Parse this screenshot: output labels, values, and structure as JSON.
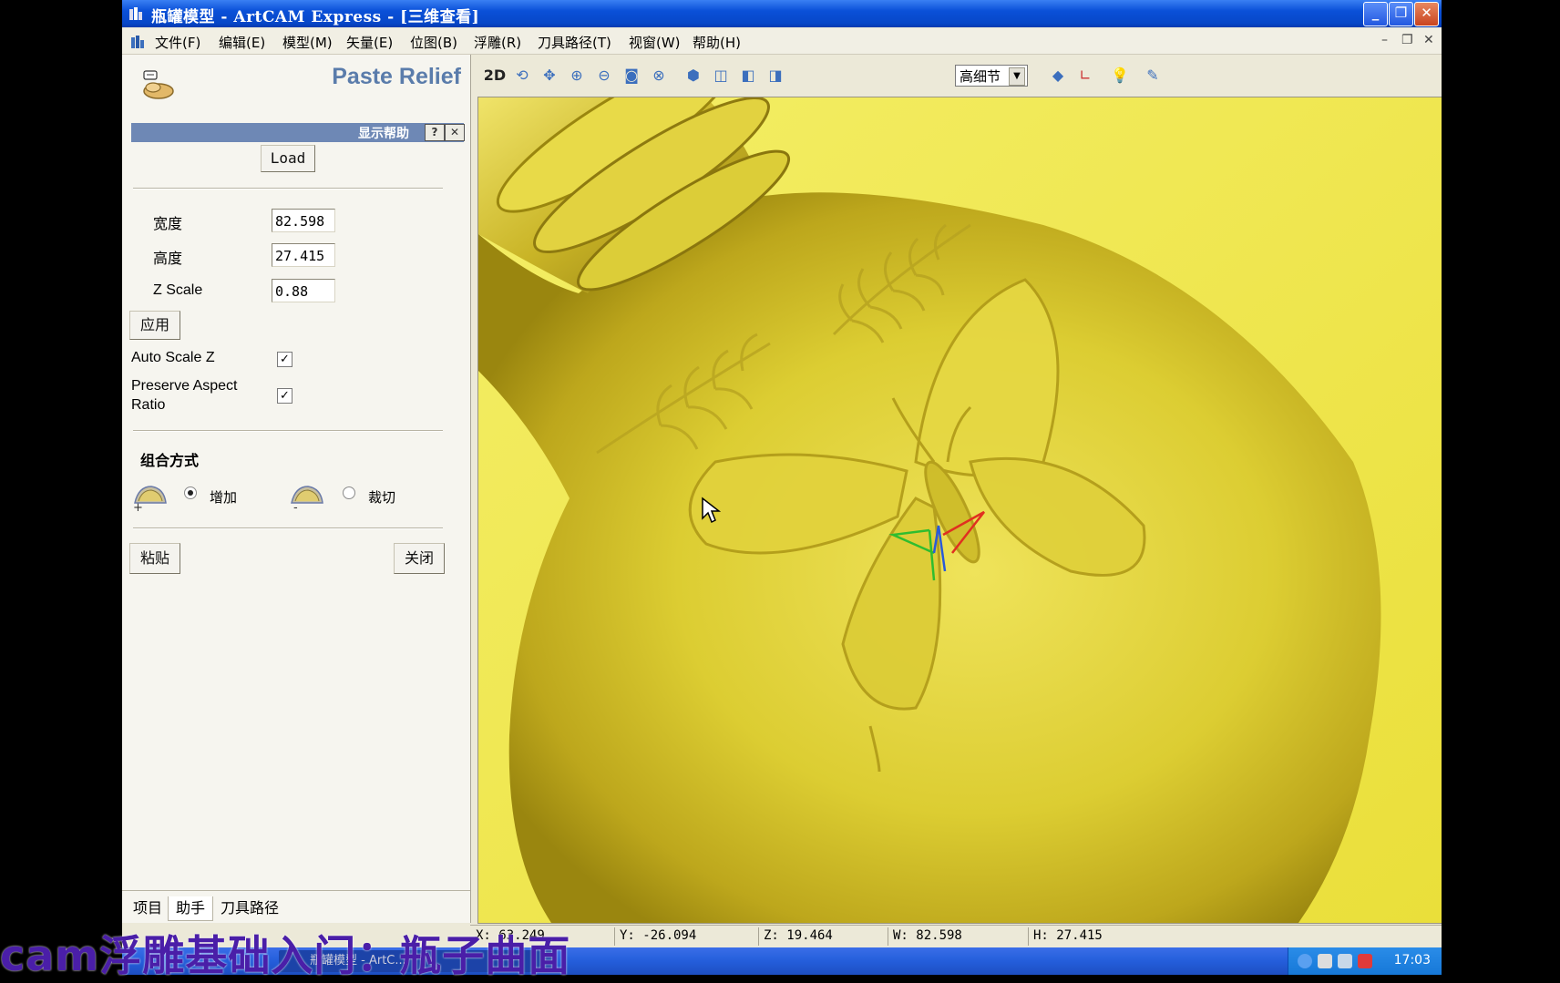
{
  "window": {
    "title": "瓶罐模型 - ArtCAM Express - [三维查看]",
    "controls": [
      "_",
      "❐",
      "✕"
    ]
  },
  "menu": {
    "items": [
      "文件(F)",
      "编辑(E)",
      "模型(M)",
      "矢量(E)",
      "位图(B)",
      "浮雕(R)",
      "刀具路径(T)",
      "视窗(W)",
      "帮助(H)"
    ],
    "mdi_controls": [
      "–",
      "❐",
      "✕"
    ]
  },
  "panel": {
    "title": "Paste Relief",
    "help_label": "显示帮助",
    "help_btn": "?",
    "help_close": "✕",
    "load_label": "Load",
    "width_label": "宽度",
    "width_value": "82.598",
    "height_label": "高度",
    "height_value": "27.415",
    "zscale_label": "Z Scale",
    "zscale_value": "0.88",
    "apply_label": "应用",
    "auto_scale_label": "Auto Scale Z",
    "auto_scale_checked": true,
    "preserve_label_1": "Preserve Aspect",
    "preserve_label_2": "Ratio",
    "preserve_checked": true,
    "combine_label": "组合方式",
    "combine_add": "增加",
    "combine_cut": "裁切",
    "combine_selected": "add",
    "plus_sign": "+",
    "minus_sign": "-",
    "paste_label": "粘贴",
    "close_label": "关闭",
    "tabs": [
      "项目",
      "助手",
      "刀具路径"
    ],
    "active_tab": "助手"
  },
  "toolbar": {
    "view_2d": "2D",
    "detail_value": "高细节",
    "icons": [
      "rotate-icon",
      "pan-icon",
      "zoom-in-icon",
      "zoom-out-icon",
      "zoom-box-icon",
      "zoom-fit-icon",
      "iso-view-icon",
      "front-view-icon",
      "side-view-icon",
      "top-view-icon",
      "relief-shade-icon",
      "axis-icon",
      "light-icon",
      "material-icon"
    ]
  },
  "status": {
    "x": "X: 63.249",
    "y": "Y: -26.094",
    "z": "Z: 19.464",
    "w": "W: 82.598",
    "h": "H: 27.415"
  },
  "taskbar": {
    "task_label": "瓶罐模型 - ArtC...",
    "clock": "17:03"
  },
  "caption": "cam浮雕基础入门：瓶子曲面",
  "colors": {
    "relief": "#e8dc3a",
    "relief_bg": "#f2ea55",
    "title_bar": "#0a50d8",
    "panel_title": "#5a7cab",
    "caption": "#4a1ea8"
  }
}
